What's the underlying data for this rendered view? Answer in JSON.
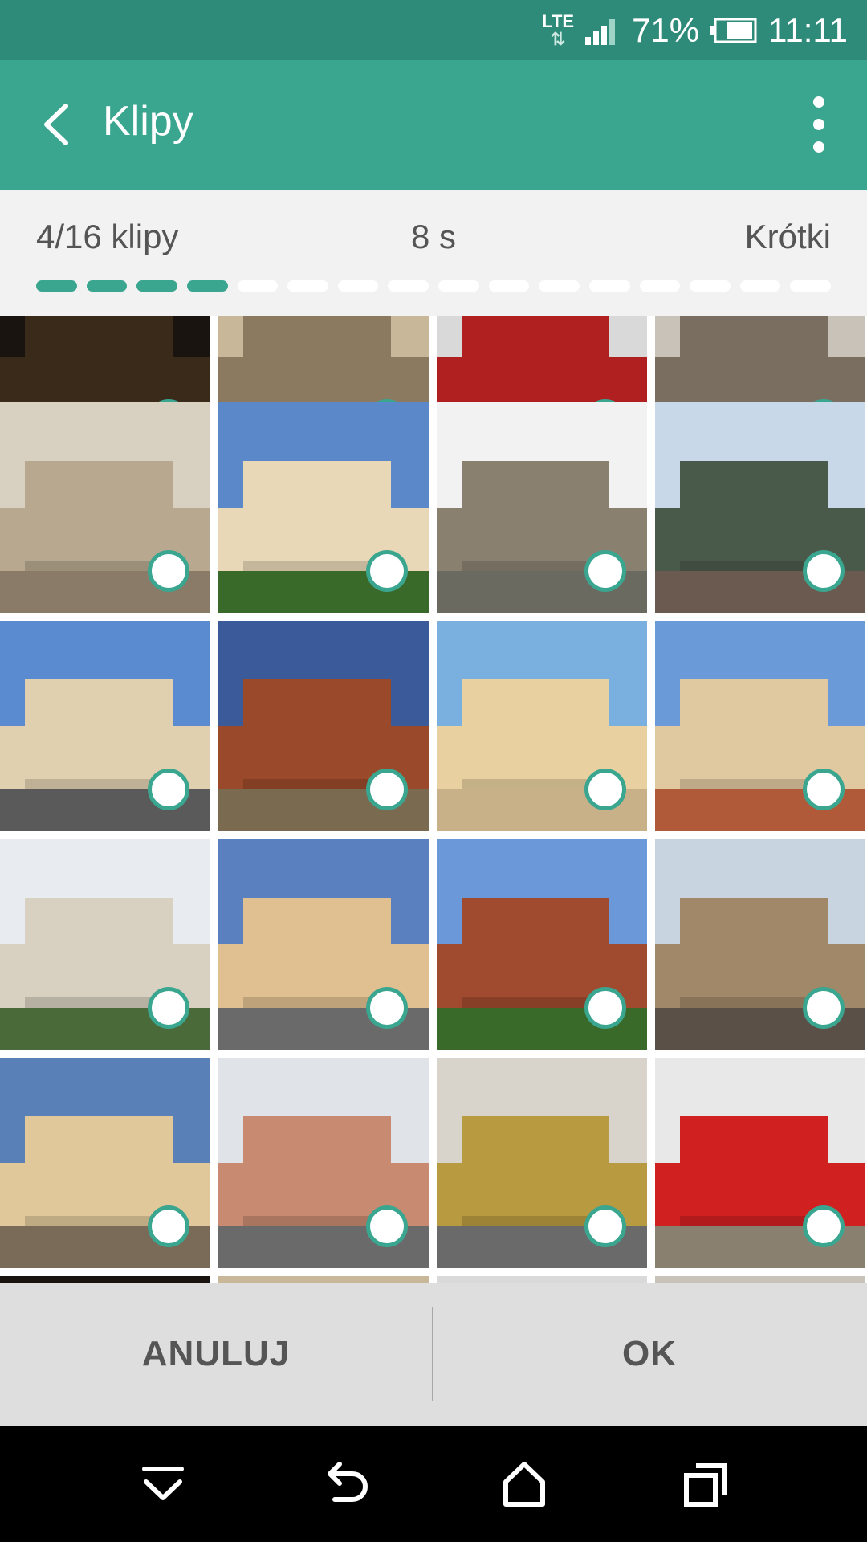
{
  "status": {
    "network": "LTE",
    "battery": "71%",
    "time": "11:11"
  },
  "appbar": {
    "title": "Klipy"
  },
  "info": {
    "clip_count": "4/16 klipy",
    "duration": "8 s",
    "length": "Krótki",
    "progress_total": 16,
    "progress_filled": 4
  },
  "actions": {
    "cancel_label": "ANULUJ",
    "ok_label": "OK"
  },
  "icons": {
    "back": "back-arrow-icon",
    "menu": "more-vert-icon",
    "nav_hide": "hide-keyboard-icon",
    "nav_back": "nav-back-icon",
    "nav_home": "home-icon",
    "nav_recents": "recents-icon"
  },
  "colors": {
    "status_bar": "#2f8b79",
    "app_bar": "#3aa690",
    "accent": "#3aa690"
  }
}
